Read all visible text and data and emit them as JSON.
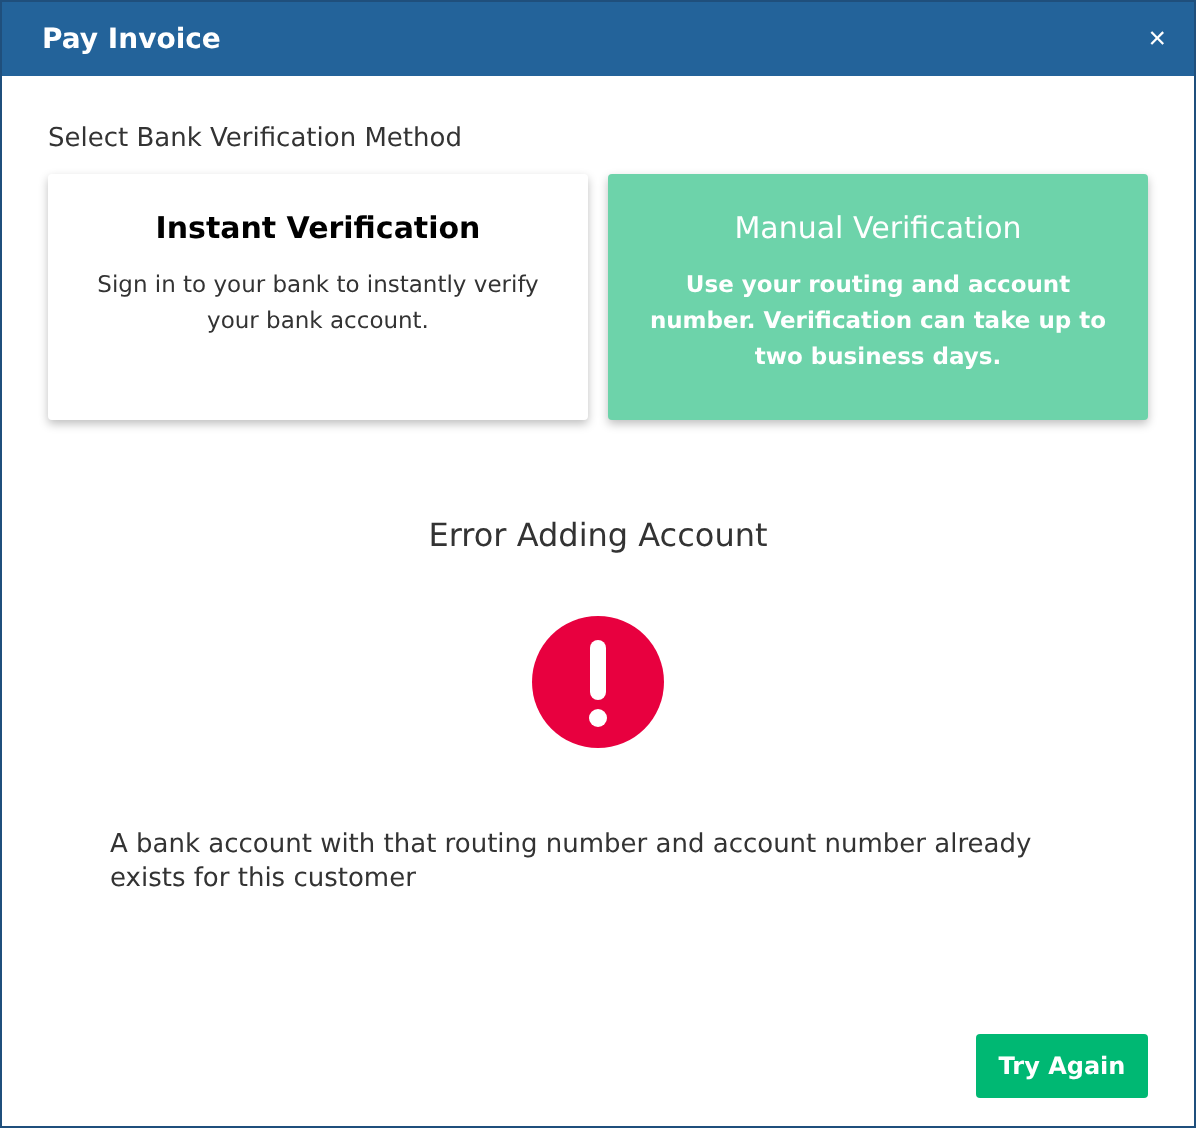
{
  "window": {
    "title": "Pay Invoice",
    "close": "×"
  },
  "section_label": "Select Bank Verification Method",
  "methods": [
    {
      "title": "Instant Verification",
      "description": "Sign in to your bank to instantly verify your bank account.",
      "selected": false
    },
    {
      "title": "Manual Verification",
      "description": "Use your routing and account number. Verification can take up to two business days.",
      "selected": true
    }
  ],
  "error": {
    "title": "Error Adding Account",
    "message": "A bank account with that routing number and account number already exists for this customer"
  },
  "buttons": [
    "Try Again"
  ]
}
